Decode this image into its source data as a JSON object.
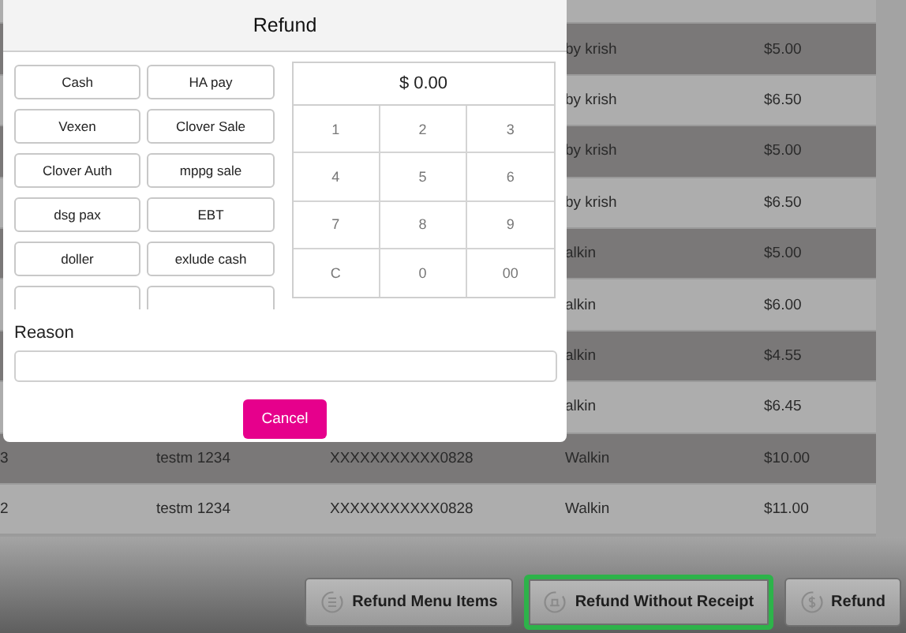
{
  "table": {
    "rows": [
      {},
      {
        "column_4": "by krish",
        "column_5": "$5.00"
      },
      {
        "column_4": "by krish",
        "column_5": "$6.50"
      },
      {
        "column_4": "by krish",
        "column_5": "$5.00"
      },
      {
        "column_4": "by krish",
        "column_5": "$6.50"
      },
      {
        "column_4": "alkin",
        "column_5": "$5.00"
      },
      {
        "column_4": "alkin",
        "column_5": "$6.00"
      },
      {
        "column_4": "alkin",
        "column_5": "$4.55"
      },
      {
        "column_4": "alkin",
        "column_5": "$6.45"
      },
      {
        "column_1": "3",
        "column_2": "testm 1234",
        "column_3": "XXXXXXXXXXX0828",
        "column_4": "Walkin",
        "column_5": "$10.00"
      },
      {
        "column_1": "2",
        "column_2": "testm 1234",
        "column_3": "XXXXXXXXXXX0828",
        "column_4": "Walkin",
        "column_5": "$11.00"
      }
    ]
  },
  "toolbar": {
    "buttons": [
      {
        "label": "Refund Menu Items",
        "highlighted": false
      },
      {
        "label": "Refund Without Receipt",
        "highlighted": true
      },
      {
        "label": "Refund",
        "highlighted": false
      }
    ]
  },
  "dialog": {
    "title": "Refund",
    "payment_methods": [
      {
        "kind": "button",
        "label": "Cash"
      },
      {
        "kind": "button",
        "label": "HA pay"
      },
      {
        "kind": "button",
        "label": "Vexen"
      },
      {
        "kind": "button",
        "label": "Clover Sale"
      },
      {
        "kind": "button",
        "label": "Clover Auth"
      },
      {
        "kind": "button",
        "label": "mppg sale"
      },
      {
        "kind": "button",
        "label": "dsg pax"
      },
      {
        "kind": "button",
        "label": "EBT"
      },
      {
        "kind": "button",
        "label": "doller"
      },
      {
        "kind": "button",
        "label": "exlude cash"
      },
      {
        "kind": "clipped"
      },
      {
        "kind": "clipped"
      }
    ],
    "amount": "$ 0.00",
    "keys": [
      "1",
      "2",
      "3",
      "4",
      "5",
      "6",
      "7",
      "8",
      "9",
      "C",
      "0",
      "00"
    ],
    "reason_label": "Reason",
    "cancel": "Cancel"
  }
}
